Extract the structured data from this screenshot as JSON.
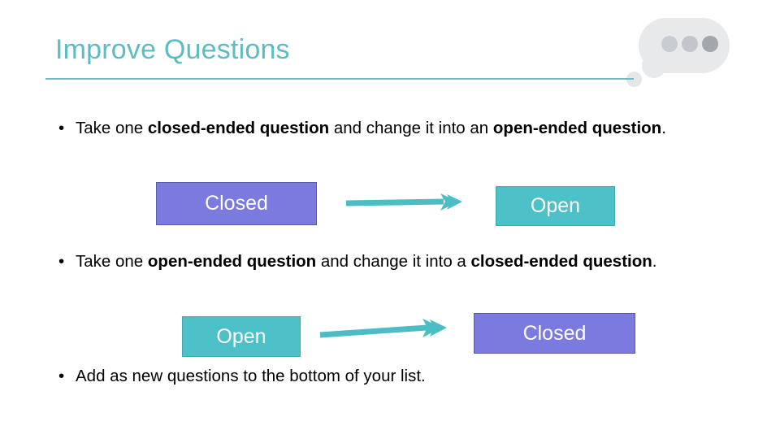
{
  "slide": {
    "title": "Improve Questions",
    "background_color": "#ffffff",
    "accent_color": "#5cbcc4",
    "closed_box_color": "#7b7ade",
    "open_box_color": "#4cc1c8",
    "arrow_color": "#4cbdc4"
  },
  "decoration": {
    "bubble_name": "speech-bubble",
    "bubble_color": "#e7e9eb",
    "dot_colors": [
      "#c9cdd1",
      "#c2c6ca",
      "#a3a7ab"
    ]
  },
  "bullets": [
    {
      "marker": "•",
      "segments": [
        {
          "text": "Take one ",
          "bold": false
        },
        {
          "text": "closed-ended question",
          "bold": true
        },
        {
          "text": " and change it into an ",
          "bold": false
        },
        {
          "text": "open-ended question",
          "bold": true
        },
        {
          "text": ".",
          "bold": false
        }
      ]
    },
    {
      "marker": "•",
      "segments": [
        {
          "text": "Take one ",
          "bold": false
        },
        {
          "text": "open-ended question",
          "bold": true
        },
        {
          "text": " and change it into a ",
          "bold": false
        },
        {
          "text": "closed-ended question",
          "bold": true
        },
        {
          "text": ".",
          "bold": false
        }
      ]
    },
    {
      "marker": "•",
      "segments": [
        {
          "text": "Add as new questions to the bottom of your list.",
          "bold": false
        }
      ]
    }
  ],
  "diagram": {
    "row_1": {
      "from_label": "Closed",
      "to_label": "Open",
      "arrow_name": "right-arrow-icon"
    },
    "row_2": {
      "from_label": "Open",
      "to_label": "Closed",
      "arrow_name": "right-arrow-icon"
    }
  }
}
